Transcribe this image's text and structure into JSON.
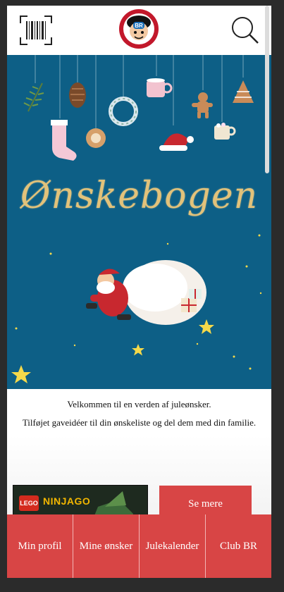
{
  "header": {
    "logo_text": "BR"
  },
  "hero": {
    "title": "Ønskebogen"
  },
  "intro": {
    "line1": "Velkommen til en verden af juleønsker.",
    "line2": "Tilføjet gaveidéer til din ønskeliste og del dem med din familie."
  },
  "product": {
    "brand": "LEGO",
    "name": "NINJAGO",
    "button_label": "Se mere"
  },
  "nav": {
    "items": [
      {
        "label": "Min profil"
      },
      {
        "label": "Mine ønsker"
      },
      {
        "label": "Julekalender"
      },
      {
        "label": "Club BR"
      }
    ]
  },
  "colors": {
    "hero_bg": "#0d5f86",
    "accent_red": "#d84545",
    "title_gold": "#e2c27a"
  }
}
